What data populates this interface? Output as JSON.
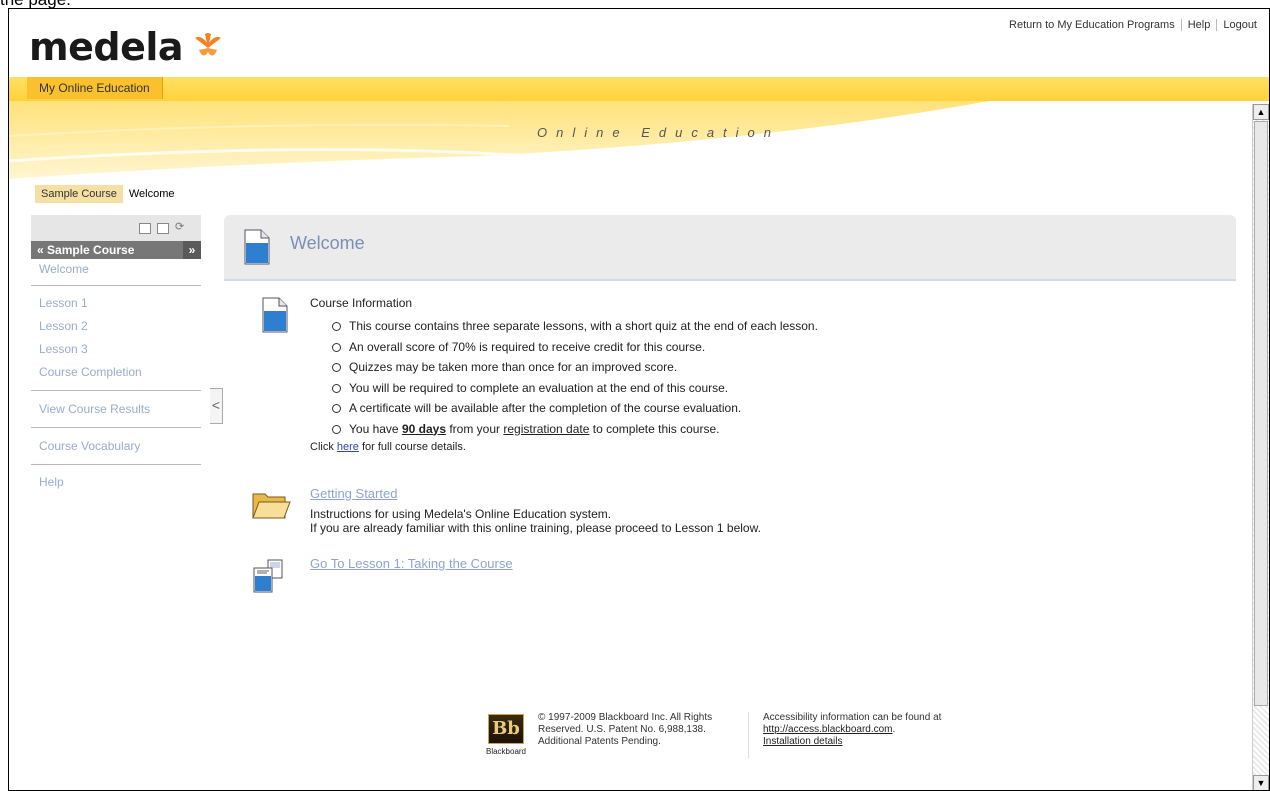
{
  "caption": "the page.",
  "brand": {
    "name": "medela"
  },
  "toplinks": [
    "Return to My Education Programs",
    "Help",
    "Logout"
  ],
  "tab": {
    "label": "My Online Education"
  },
  "banner": {
    "title": "Online Education"
  },
  "breadcrumb": {
    "course": "Sample Course",
    "page": "Welcome"
  },
  "leftnav": {
    "header": "Sample Course",
    "header_expand": "»",
    "collapse_toggle": "«",
    "items": [
      "Welcome",
      "Lesson 1",
      "Lesson 2",
      "Lesson 3",
      "Course Completion",
      "View Course Results",
      "Course Vocabulary",
      "Help"
    ]
  },
  "content": {
    "title": "Welcome",
    "course_info": {
      "heading": "Course Information",
      "items": [
        "This course contains three separate lessons, with a short quiz at the end of each lesson.",
        "An overall score of 70% is required to receive credit for this course.",
        "Quizzes may be taken more than once for an improved score.",
        "You will be required to complete an evaluation at the end of this course.",
        "A certificate will be available after the completion of the course evaluation."
      ],
      "last_item": {
        "prefix": "You have ",
        "days": "90 days",
        "middle": " from your ",
        "link": "registration date",
        "suffix": " to complete this course."
      },
      "click": {
        "prefix": "Click ",
        "link": "here",
        "suffix": " for full course details."
      }
    },
    "getting_started": {
      "link": "Getting Started",
      "line1": "Instructions for using Medela's Online Education system.",
      "line2": "If you are already familiar with this online training, please proceed to Lesson 1 below."
    },
    "lesson1": {
      "link": "Go To Lesson 1: Taking the Course"
    }
  },
  "footer": {
    "logo_text": "Bb",
    "logo_caption": "Blackboard",
    "copy": "© 1997-2009 Blackboard Inc. All Rights Reserved. U.S. Patent No. 6,988,138. Additional Patents Pending.",
    "access_text": "Accessibility information can be found at",
    "access_link": "http://access.blackboard.com",
    "install_link": "Installation details"
  },
  "scrollbar": {
    "up_arrow": "▲",
    "down_arrow": "▼"
  },
  "colors": {
    "accent": "#fbc02d",
    "link": "#8fa3cc"
  }
}
